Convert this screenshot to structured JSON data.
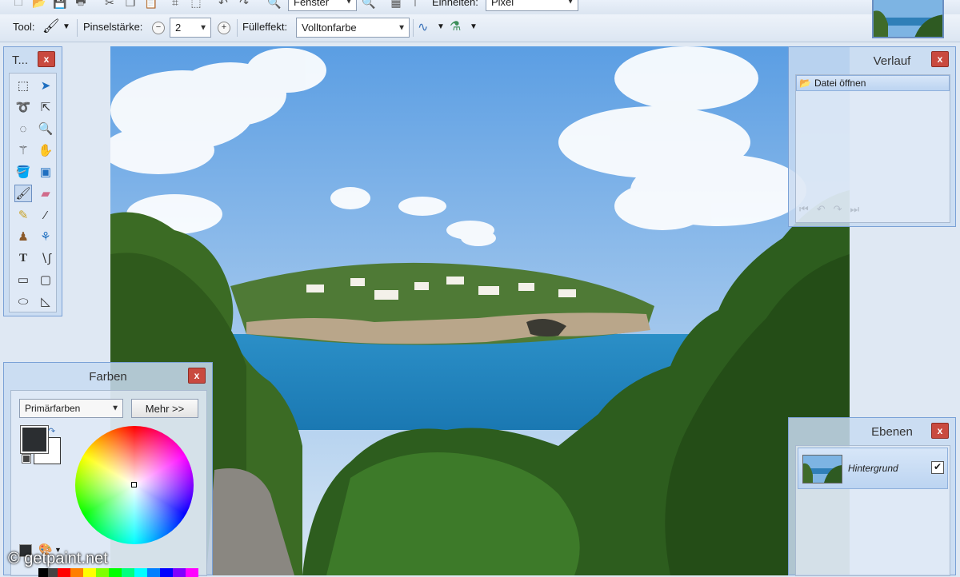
{
  "toolbar1": {
    "zoom_value": "Fenster",
    "units_label": "Einheiten:",
    "units_value": "Pixel",
    "icons": [
      "new-icon",
      "open-icon",
      "save-icon",
      "print-icon",
      "cut-icon",
      "copy-icon",
      "paste-icon",
      "crop-icon",
      "deselect-icon",
      "undo-icon",
      "redo-icon",
      "zoom-icon",
      "zoom-in-icon",
      "grid-icon",
      "ruler-icon"
    ]
  },
  "toolbar2": {
    "tool_label": "Tool:",
    "brush_label": "Pinselstärke:",
    "brush_value": "2",
    "fill_label": "Fülleffekt:",
    "fill_value": "Volltonfarbe"
  },
  "tools_panel": {
    "title": "T...",
    "close": "x",
    "tools": [
      "rect-select-icon",
      "move-selection-icon",
      "lasso-select-icon",
      "move-selected-icon",
      "ellipse-select-icon",
      "zoom-icon",
      "magic-wand-icon",
      "pan-icon",
      "paint-bucket-icon",
      "gradient-icon",
      "paintbrush-icon",
      "eraser-icon",
      "pencil-icon",
      "color-picker-icon",
      "clone-stamp-icon",
      "recolor-icon",
      "text-icon",
      "line-curve-icon",
      "rectangle-icon",
      "rounded-rect-icon",
      "ellipse-icon",
      "freeform-shape-icon"
    ]
  },
  "history_panel": {
    "title": "Verlauf",
    "close": "x",
    "items": [
      {
        "label": "Datei öffnen"
      }
    ]
  },
  "layers_panel": {
    "title": "Ebenen",
    "close": "x",
    "layers": [
      {
        "name": "Hintergrund",
        "visible": true
      }
    ]
  },
  "colors_panel": {
    "title": "Farben",
    "close": "x",
    "palette_select": "Primärfarben",
    "more_button": "Mehr >>",
    "primary_color": "#2b2e31",
    "secondary_color": "#ffffff"
  },
  "watermark": "© getpaint.net",
  "colors": {
    "accent": "#7aa1d6",
    "close_red": "#c94a3f"
  }
}
